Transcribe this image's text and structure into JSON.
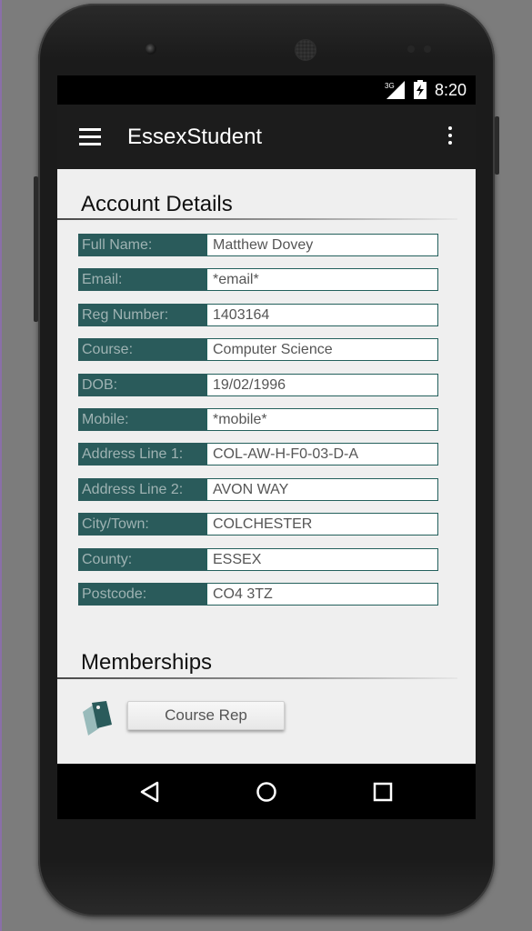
{
  "status": {
    "network": "3G",
    "time": "8:20"
  },
  "appbar": {
    "title": "EssexStudent"
  },
  "account": {
    "title": "Account Details",
    "fields": [
      {
        "label": "Full Name:",
        "value": "Matthew Dovey"
      },
      {
        "label": "Email:",
        "value": "*email*"
      },
      {
        "label": "Reg Number:",
        "value": "1403164"
      },
      {
        "label": "Course:",
        "value": "Computer Science"
      },
      {
        "label": "DOB:",
        "value": "19/02/1996"
      },
      {
        "label": "Mobile:",
        "value": "*mobile*"
      },
      {
        "label": "Address Line 1:",
        "value": "COL-AW-H-F0-03-D-A"
      },
      {
        "label": "Address Line 2:",
        "value": "AVON WAY"
      },
      {
        "label": "City/Town:",
        "value": "COLCHESTER"
      },
      {
        "label": "County:",
        "value": "ESSEX"
      },
      {
        "label": "Postcode:",
        "value": "CO4 3TZ"
      }
    ]
  },
  "memberships": {
    "title": "Memberships",
    "items": [
      {
        "label": "Course Rep",
        "icon": "tag-icon",
        "icon_color": "#2a5b5b"
      }
    ]
  },
  "colors": {
    "label_bg": "#2a5b5b",
    "appbar_bg": "#1c1c1c",
    "screen_bg": "#efefef"
  }
}
